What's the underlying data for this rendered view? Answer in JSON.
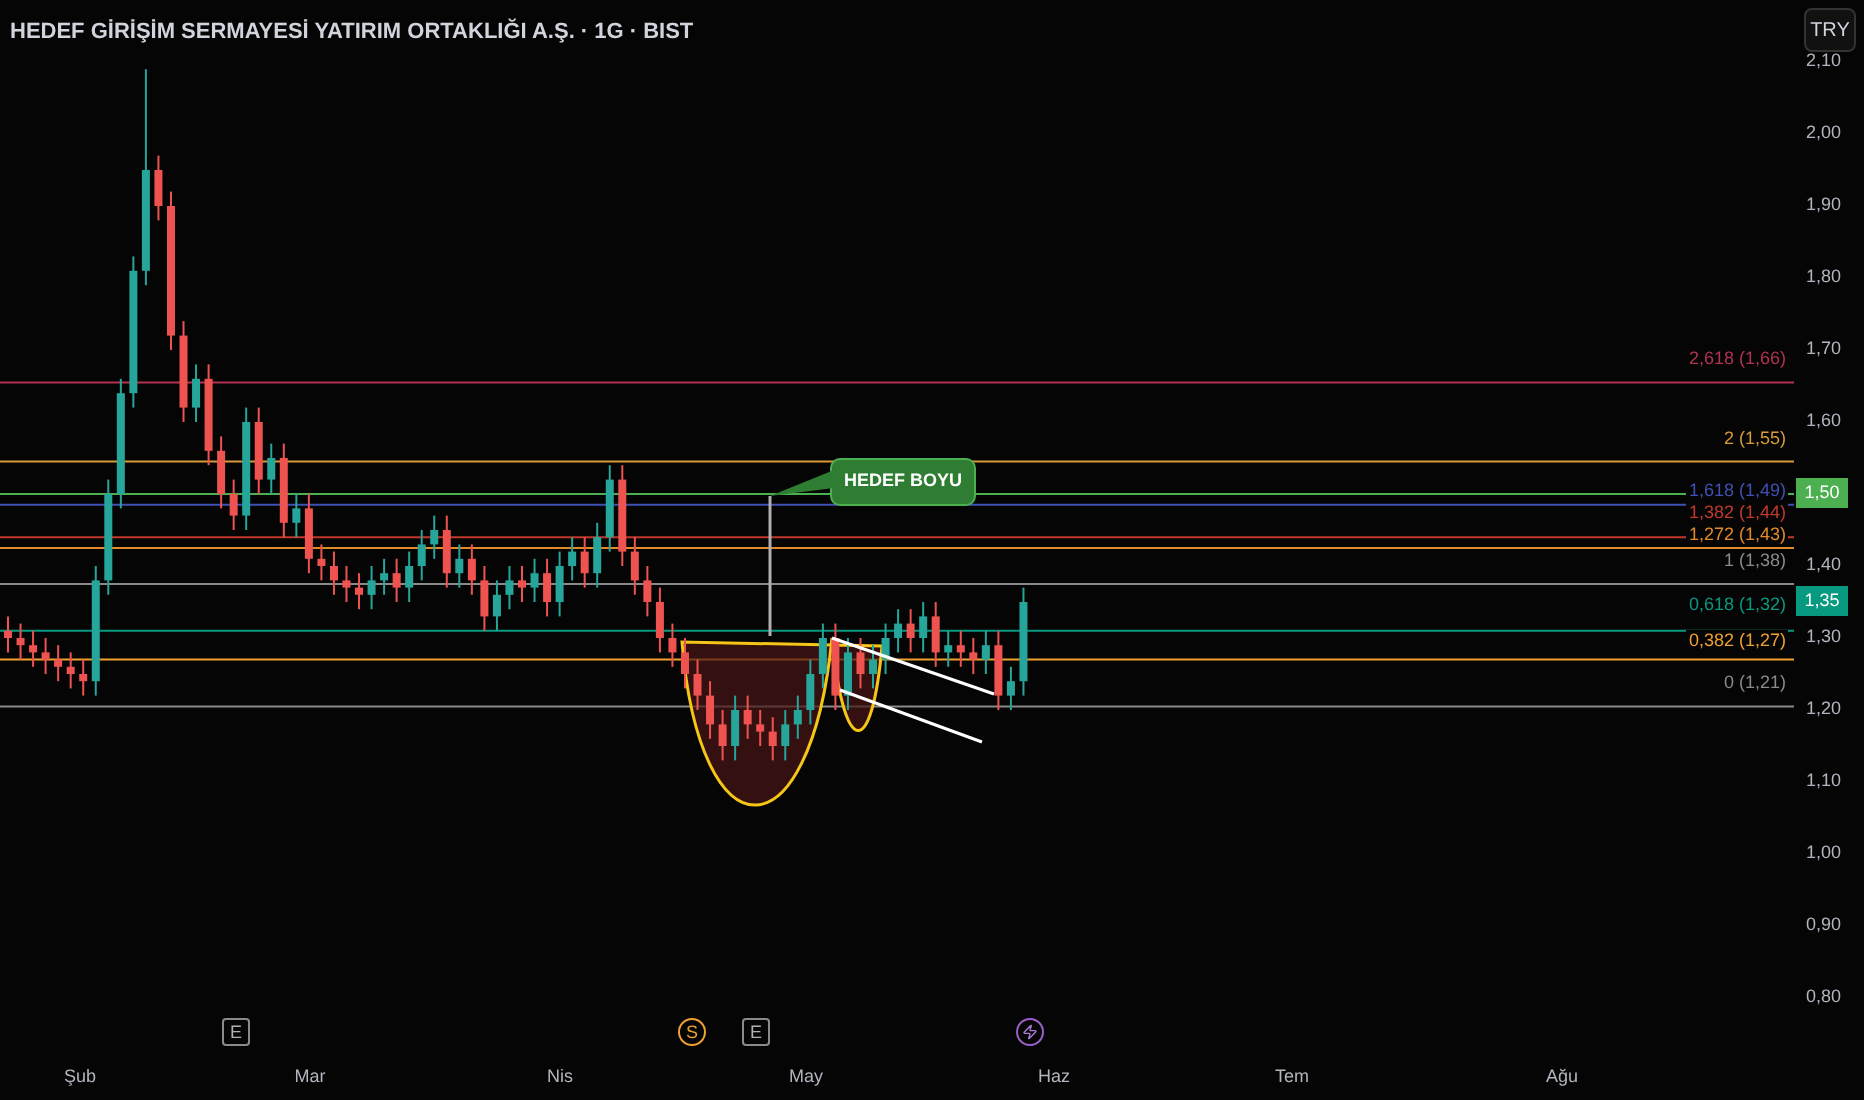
{
  "header": {
    "title": "HEDEF GİRİŞİM SERMAYESİ YATIRIM ORTAKLIĞI A.Ş. · 1G · BIST"
  },
  "currency_button": {
    "label": "TRY"
  },
  "price_axis": {
    "ticks": [
      "2,10",
      "2,00",
      "1,90",
      "1,80",
      "1,70",
      "1,60",
      "1,40",
      "1,30",
      "1,20",
      "1,10",
      "1,00",
      "0,90",
      "0,80"
    ]
  },
  "price_tags": [
    {
      "label": "1,50",
      "color": "#4caf50"
    },
    {
      "label": "1,35",
      "color": "#089981"
    }
  ],
  "fib_levels": [
    {
      "label": "2,618 (1,66)",
      "color": "#b2334f"
    },
    {
      "label": "2 (1,55)",
      "color": "#d99a3a"
    },
    {
      "label": "1,618 (1,49)",
      "color": "#3f51b5"
    },
    {
      "label": "1,382 (1,44)",
      "color": "#c0392b"
    },
    {
      "label": "1,272 (1,43)",
      "color": "#e08a2a"
    },
    {
      "label": "1 (1,38)",
      "color": "#8a8a8a"
    },
    {
      "label": "0,618 (1,32)",
      "color": "#089981"
    },
    {
      "label": "0,382 (1,27)",
      "color": "#f0a030"
    },
    {
      "label": "0 (1,21)",
      "color": "#8a8a8a"
    }
  ],
  "annotation": {
    "label": "HEDEF BOYU"
  },
  "events": [
    {
      "kind": "earnings",
      "label": "E"
    },
    {
      "kind": "split",
      "label": "S"
    },
    {
      "kind": "earnings",
      "label": "E"
    },
    {
      "kind": "flash"
    }
  ],
  "time_axis": [
    "Şub",
    "Mar",
    "Nis",
    "May",
    "Haz",
    "Tem",
    "Ağu"
  ]
}
